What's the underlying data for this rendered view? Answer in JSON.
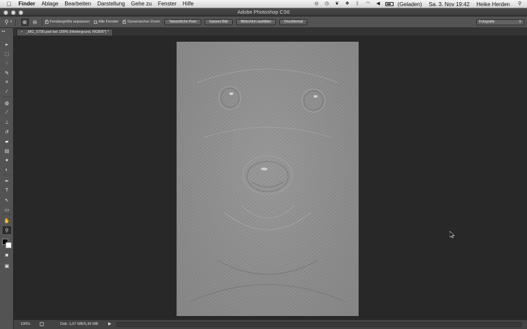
{
  "menubar": {
    "items": [
      "Finder",
      "Ablage",
      "Bearbeiten",
      "Darstellung",
      "Gehe zu",
      "Fenster",
      "Hilfe"
    ],
    "battery_status": "(Geladen)",
    "datetime": "Sa. 3. Nov 19:42",
    "user": "Heike Herden"
  },
  "window": {
    "title": "Adobe Photoshop CS6"
  },
  "options_bar": {
    "checks": [
      {
        "label": "Fenstergröße anpassen",
        "checked": true
      },
      {
        "label": "Alle Fenster",
        "checked": false
      },
      {
        "label": "Dynamischer Zoom",
        "checked": true
      }
    ],
    "buttons": [
      "Tatsächliche Pixel",
      "Ganzes Bild",
      "Bildschirm ausfüllen",
      "Druckformat"
    ],
    "workspace": "Fotografie"
  },
  "document": {
    "tab_label": "_MG_5790.psd bei 100% (Hintergrund, RGB/8*) *",
    "close_glyph": "×"
  },
  "tools": {
    "grip": "◂◂",
    "items": [
      {
        "name": "move-tool-icon",
        "glyph": "▸"
      },
      {
        "name": "marquee-tool-icon",
        "glyph": "⬚"
      },
      {
        "name": "lasso-tool-icon",
        "glyph": "◌"
      },
      {
        "name": "quick-selection-tool-icon",
        "glyph": "✎"
      },
      {
        "name": "crop-tool-icon",
        "glyph": "⌗"
      },
      {
        "name": "eyedropper-tool-icon",
        "glyph": "⁄"
      },
      {
        "name": "spot-healing-tool-icon",
        "glyph": "◍"
      },
      {
        "name": "brush-tool-icon",
        "glyph": "∕"
      },
      {
        "name": "clone-stamp-tool-icon",
        "glyph": "⊥"
      },
      {
        "name": "history-brush-tool-icon",
        "glyph": "↺"
      },
      {
        "name": "eraser-tool-icon",
        "glyph": "▰"
      },
      {
        "name": "gradient-tool-icon",
        "glyph": "▤"
      },
      {
        "name": "blur-tool-icon",
        "glyph": "●"
      },
      {
        "name": "dodge-tool-icon",
        "glyph": "◐"
      },
      {
        "name": "pen-tool-icon",
        "glyph": "✒"
      },
      {
        "name": "type-tool-icon",
        "glyph": "T"
      },
      {
        "name": "path-selection-tool-icon",
        "glyph": "↖"
      },
      {
        "name": "shape-tool-icon",
        "glyph": "▭"
      },
      {
        "name": "hand-tool-icon",
        "glyph": "✋"
      },
      {
        "name": "zoom-tool-icon",
        "glyph": "⚲"
      }
    ],
    "active_tool": "zoom-tool-icon",
    "foreground_color": "#000000",
    "background_color": "#ffffff"
  },
  "status_bar": {
    "zoom": "100%",
    "doc_size": "Dok: 1,07 MB/5,36 MB",
    "arrow": "▶"
  },
  "colors": {
    "ui_dark": "#282828",
    "panel": "#535353",
    "image_gray": "#8a8a8a"
  }
}
